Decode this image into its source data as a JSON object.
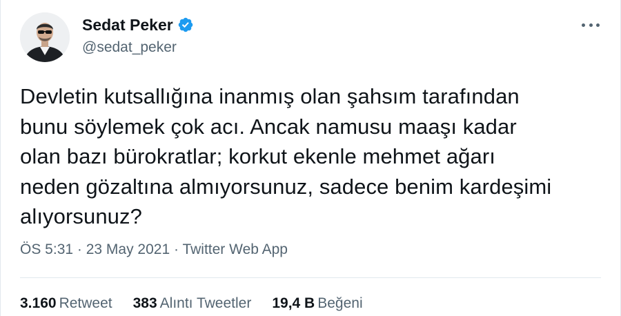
{
  "user": {
    "display_name": "Sedat Peker",
    "handle": "@sedat_peker",
    "verified_icon": "verified-badge-icon",
    "accent_color": "#1d9bf0"
  },
  "tweet": {
    "lines": [
      "Devletin kutsallığına inanmış olan şahsım tarafından",
      "bunu söylemek çok acı. Ancak namusu maaşı kadar",
      "olan bazı bürokratlar; korkut ekenle mehmet ağarı",
      "neden gözaltına almıyorsunuz, sadece benim kardeşimi",
      "alıyorsunuz?"
    ]
  },
  "meta": {
    "time": "ÖS 5:31",
    "separator": "·",
    "date": "23 May 2021",
    "source": "Twitter Web App"
  },
  "stats": {
    "retweets_count": "3.160",
    "retweets_label": "Retweet",
    "quotes_count": "383",
    "quotes_label": "Alıntı Tweetler",
    "likes_count": "19,4 B",
    "likes_label": "Beğeni"
  },
  "menu": {
    "icon": "more-options-icon"
  }
}
